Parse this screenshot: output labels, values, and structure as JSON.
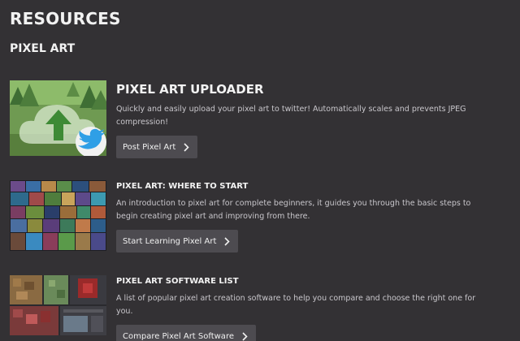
{
  "page": {
    "title": "RESOURCES"
  },
  "section": {
    "title": "PIXEL ART"
  },
  "cards": [
    {
      "title": "PIXEL ART UPLOADER",
      "description": "Quickly and easily upload your pixel art to twitter! Automatically scales and prevents JPEG compression!",
      "button_label": "Post Pixel Art",
      "thumbnail_icons": [
        "cloud-upload-icon",
        "twitter-bird-icon"
      ]
    },
    {
      "title": "PIXEL ART: WHERE TO START",
      "description": "An introduction to pixel art for complete beginners, it guides you through the basic steps to begin creating pixel art and improving from there.",
      "button_label": "Start Learning Pixel Art"
    },
    {
      "title": "PIXEL ART SOFTWARE LIST",
      "description": "A list of popular pixel art creation software to help you compare and choose the right one for you.",
      "button_label": "Compare Pixel Art Software"
    }
  ],
  "colors": {
    "background": "#333134",
    "button": "#4d4b50",
    "text": "#f2f2f2",
    "muted_text": "#c9c7cc",
    "twitter_blue": "#2f9fe6"
  }
}
